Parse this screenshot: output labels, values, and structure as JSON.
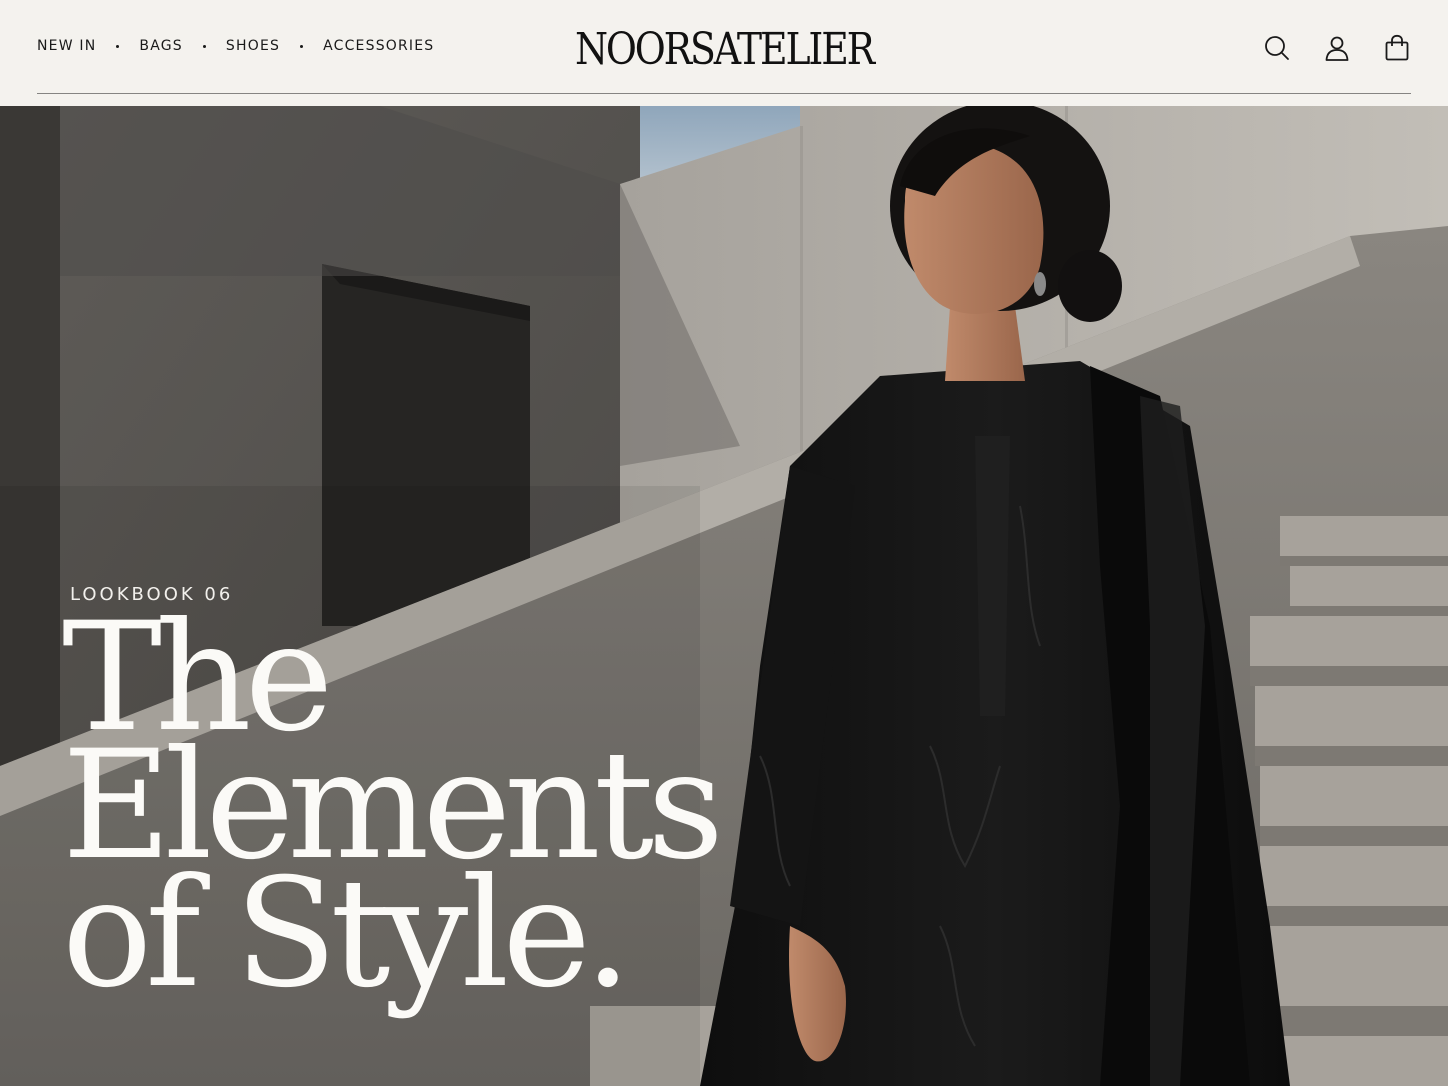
{
  "nav": {
    "items": [
      {
        "label": "NEW IN"
      },
      {
        "label": "BAGS"
      },
      {
        "label": "SHOES"
      },
      {
        "label": "ACCESSORIES"
      }
    ]
  },
  "brand": {
    "logo_text": "NOORSATELIER"
  },
  "header_icons": [
    "search-icon",
    "account-icon",
    "shopping-bag-icon"
  ],
  "hero": {
    "eyebrow": "LOOKBOOK 06",
    "headline": [
      "The",
      "Elements",
      "of Style."
    ]
  },
  "colors": {
    "background": "#f4f2ee",
    "text_dark": "#111111",
    "hero_text": "#fbfaf7",
    "garment": "#121212"
  }
}
